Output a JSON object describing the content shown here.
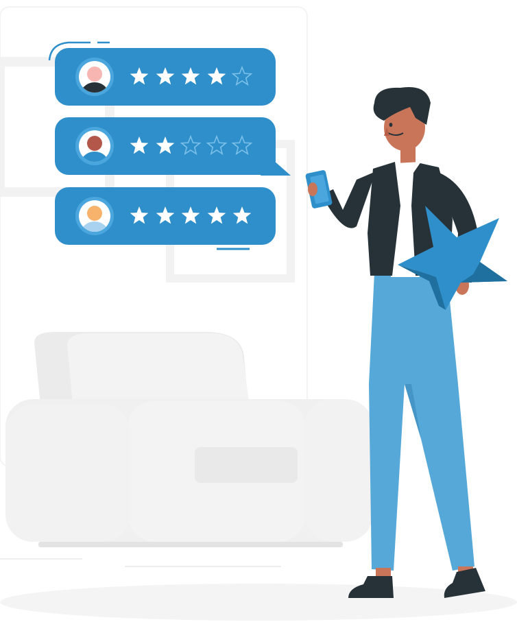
{
  "colors": {
    "card": "#2e8fca",
    "card_ring": "#4aa6dd",
    "star_filled": "#ffffff",
    "star_empty_stroke": "#7cc0ea",
    "shirt": "#263238",
    "pants": "#56a8d8",
    "skin": "#c97559",
    "hair": "#263238",
    "couch": "#f0f0f0",
    "couch_shadow": "#e4e4e4"
  },
  "reviews": [
    {
      "avatar": "user-avatar-pink",
      "head_color": "#f7b6b1",
      "body_color": "#263238",
      "rating": 4,
      "max": 5
    },
    {
      "avatar": "user-avatar-brown",
      "head_color": "#b3574b",
      "body_color": "#2e8fca",
      "rating": 2,
      "max": 5
    },
    {
      "avatar": "user-avatar-orange",
      "head_color": "#f7b26b",
      "body_color": "#a8d2ef",
      "rating": 5,
      "max": 5
    }
  ],
  "icons": {
    "star": "star-icon",
    "person": "person-holding-phone-illustration",
    "big_star": "large-3d-star-icon",
    "couch": "couch-illustration"
  }
}
